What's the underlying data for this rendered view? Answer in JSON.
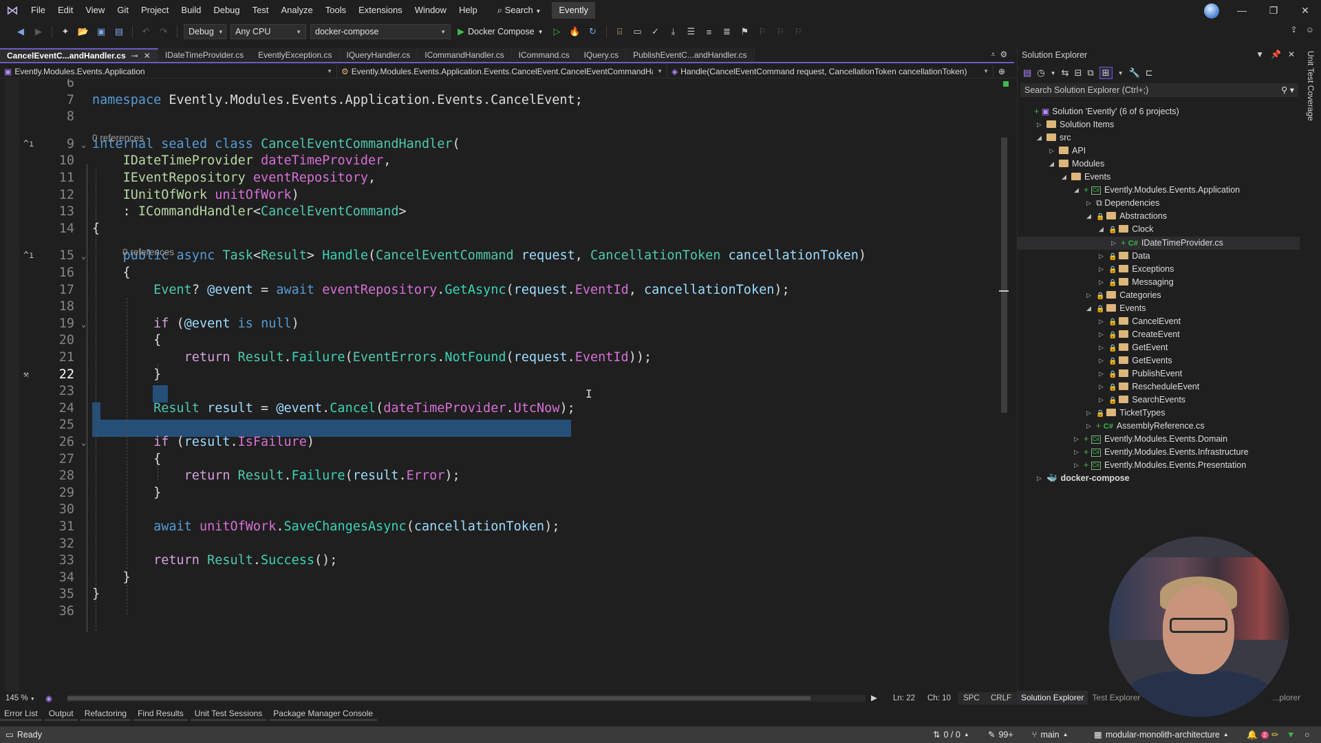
{
  "titlebar": {
    "menu": [
      "File",
      "Edit",
      "View",
      "Git",
      "Project",
      "Build",
      "Debug",
      "Test",
      "Analyze",
      "Tools",
      "Extensions",
      "Window",
      "Help"
    ],
    "search_label": "Search",
    "solution_name": "Evently"
  },
  "toolbar": {
    "configuration": "Debug",
    "platform": "Any CPU",
    "startup_project": "docker-compose",
    "run_label": "Docker Compose"
  },
  "doc_tabs": [
    {
      "label": "CancelEventC...andHandler.cs",
      "active": true
    },
    {
      "label": "IDateTimeProvider.cs"
    },
    {
      "label": "EventlyException.cs"
    },
    {
      "label": "IQueryHandler.cs"
    },
    {
      "label": "ICommandHandler.cs"
    },
    {
      "label": "ICommand.cs"
    },
    {
      "label": "IQuery.cs"
    },
    {
      "label": "PublishEventC...andHandler.cs"
    }
  ],
  "navbar": {
    "project": "Evently.Modules.Events.Application",
    "type": "Evently.Modules.Events.Application.Events.CancelEvent.CancelEventCommandHandler",
    "member": "Handle(CancelEventCommand request, CancellationToken cancellationToken)"
  },
  "editor": {
    "codelens": [
      "0 references",
      "0 references"
    ],
    "lines": [
      {
        "n": "6"
      },
      {
        "n": "7"
      },
      {
        "n": "8"
      },
      {
        "n": "9"
      },
      {
        "n": "10"
      },
      {
        "n": "11"
      },
      {
        "n": "12"
      },
      {
        "n": "13"
      },
      {
        "n": "14"
      },
      {
        "n": "15"
      },
      {
        "n": "16"
      },
      {
        "n": "17"
      },
      {
        "n": "18"
      },
      {
        "n": "19"
      },
      {
        "n": "20"
      },
      {
        "n": "21"
      },
      {
        "n": "22"
      },
      {
        "n": "23"
      },
      {
        "n": "24"
      },
      {
        "n": "25"
      },
      {
        "n": "26"
      },
      {
        "n": "27"
      },
      {
        "n": "28"
      },
      {
        "n": "29"
      },
      {
        "n": "30"
      },
      {
        "n": "31"
      },
      {
        "n": "32"
      },
      {
        "n": "33"
      },
      {
        "n": "34"
      },
      {
        "n": "35"
      },
      {
        "n": "36"
      }
    ],
    "tokens": {
      "l7": [
        [
          "kw",
          "namespace"
        ],
        [
          "pl",
          " Evently.Modules.Events.Application.Events.CancelEvent;"
        ]
      ],
      "l9": [
        [
          "kw",
          "internal"
        ],
        [
          "pl",
          " "
        ],
        [
          "kw",
          "sealed"
        ],
        [
          "pl",
          " "
        ],
        [
          "kw",
          "class"
        ],
        [
          "pl",
          " "
        ],
        [
          "cl",
          "CancelEventCommandHandler"
        ],
        [
          "pl",
          "("
        ]
      ],
      "l10": [
        [
          "pl",
          "    "
        ],
        [
          "ty",
          "IDateTimeProvider"
        ],
        [
          "pl",
          " "
        ],
        [
          "pr",
          "dateTimeProvider"
        ],
        [
          "pl",
          ","
        ]
      ],
      "l11": [
        [
          "pl",
          "    "
        ],
        [
          "ty",
          "IEventRepository"
        ],
        [
          "pl",
          " "
        ],
        [
          "pr",
          "eventRepository"
        ],
        [
          "pl",
          ","
        ]
      ],
      "l12": [
        [
          "pl",
          "    "
        ],
        [
          "ty",
          "IUnitOfWork"
        ],
        [
          "pl",
          " "
        ],
        [
          "pr",
          "unitOfWork"
        ],
        [
          "pl",
          ")"
        ]
      ],
      "l13": [
        [
          "pl",
          "    : "
        ],
        [
          "ty",
          "ICommandHandler"
        ],
        [
          "pl",
          "<"
        ],
        [
          "cl",
          "CancelEventCommand"
        ],
        [
          "pl",
          ">"
        ]
      ],
      "l14": [
        [
          "pl",
          "{"
        ]
      ],
      "l15": [
        [
          "pl",
          "    "
        ],
        [
          "kw",
          "public"
        ],
        [
          "pl",
          " "
        ],
        [
          "kw",
          "async"
        ],
        [
          "pl",
          " "
        ],
        [
          "cl",
          "Task"
        ],
        [
          "pl",
          "<"
        ],
        [
          "cl",
          "Result"
        ],
        [
          "pl",
          "> "
        ],
        [
          "me",
          "Handle"
        ],
        [
          "pl",
          "("
        ],
        [
          "cl",
          "CancelEventCommand"
        ],
        [
          "pl",
          " "
        ],
        [
          "pa",
          "request"
        ],
        [
          "pl",
          ", "
        ],
        [
          "cl",
          "CancellationToken"
        ],
        [
          "pl",
          " "
        ],
        [
          "pa",
          "cancellationToken"
        ],
        [
          "pl",
          ")"
        ]
      ],
      "l16": [
        [
          "pl",
          "    {"
        ]
      ],
      "l17": [
        [
          "pl",
          "        "
        ],
        [
          "cl",
          "Event"
        ],
        [
          "pl",
          "? "
        ],
        [
          "pa",
          "@event"
        ],
        [
          "pl",
          " = "
        ],
        [
          "kw",
          "await"
        ],
        [
          "pl",
          " "
        ],
        [
          "pr",
          "eventRepository"
        ],
        [
          "pl",
          "."
        ],
        [
          "me",
          "GetAsync"
        ],
        [
          "pl",
          "("
        ],
        [
          "pa",
          "request"
        ],
        [
          "pl",
          "."
        ],
        [
          "pr",
          "EventId"
        ],
        [
          "pl",
          ", "
        ],
        [
          "pa",
          "cancellationToken"
        ],
        [
          "pl",
          ");"
        ]
      ],
      "l19": [
        [
          "pl",
          "        "
        ],
        [
          "kw2",
          "if"
        ],
        [
          "pl",
          " ("
        ],
        [
          "pa",
          "@event"
        ],
        [
          "pl",
          " "
        ],
        [
          "kw",
          "is"
        ],
        [
          "pl",
          " "
        ],
        [
          "kw",
          "null"
        ],
        [
          "pl",
          ")"
        ]
      ],
      "l20": [
        [
          "pl",
          "        {"
        ]
      ],
      "l21": [
        [
          "pl",
          "            "
        ],
        [
          "kw2",
          "return"
        ],
        [
          "pl",
          " "
        ],
        [
          "cl",
          "Result"
        ],
        [
          "pl",
          "."
        ],
        [
          "me",
          "Failure"
        ],
        [
          "pl",
          "("
        ],
        [
          "cl",
          "EventErrors"
        ],
        [
          "pl",
          "."
        ],
        [
          "me",
          "NotFound"
        ],
        [
          "pl",
          "("
        ],
        [
          "pa",
          "request"
        ],
        [
          "pl",
          "."
        ],
        [
          "pr",
          "EventId"
        ],
        [
          "pl",
          "));"
        ]
      ],
      "l22": [
        [
          "pl",
          "        }"
        ]
      ],
      "l24": [
        [
          "pl",
          "        "
        ],
        [
          "cl",
          "Result"
        ],
        [
          "pl",
          " "
        ],
        [
          "pa",
          "result"
        ],
        [
          "pl",
          " = "
        ],
        [
          "pa",
          "@event"
        ],
        [
          "pl",
          "."
        ],
        [
          "me",
          "Cancel"
        ],
        [
          "pl",
          "("
        ],
        [
          "pr",
          "dateTimeProvider"
        ],
        [
          "pl",
          "."
        ],
        [
          "pr",
          "UtcNow"
        ],
        [
          "pl",
          ");"
        ]
      ],
      "l26": [
        [
          "pl",
          "        "
        ],
        [
          "kw2",
          "if"
        ],
        [
          "pl",
          " ("
        ],
        [
          "pa",
          "result"
        ],
        [
          "pl",
          "."
        ],
        [
          "pr",
          "IsFailure"
        ],
        [
          "pl",
          ")"
        ]
      ],
      "l27": [
        [
          "pl",
          "        {"
        ]
      ],
      "l28": [
        [
          "pl",
          "            "
        ],
        [
          "kw2",
          "return"
        ],
        [
          "pl",
          " "
        ],
        [
          "cl",
          "Result"
        ],
        [
          "pl",
          "."
        ],
        [
          "me",
          "Failure"
        ],
        [
          "pl",
          "("
        ],
        [
          "pa",
          "result"
        ],
        [
          "pl",
          "."
        ],
        [
          "pr",
          "Error"
        ],
        [
          "pl",
          ");"
        ]
      ],
      "l29": [
        [
          "pl",
          "        }"
        ]
      ],
      "l31": [
        [
          "pl",
          "        "
        ],
        [
          "kw",
          "await"
        ],
        [
          "pl",
          " "
        ],
        [
          "pr",
          "unitOfWork"
        ],
        [
          "pl",
          "."
        ],
        [
          "me",
          "SaveChangesAsync"
        ],
        [
          "pl",
          "("
        ],
        [
          "pa",
          "cancellationToken"
        ],
        [
          "pl",
          ");"
        ]
      ],
      "l33": [
        [
          "pl",
          "        "
        ],
        [
          "kw2",
          "return"
        ],
        [
          "pl",
          " "
        ],
        [
          "cl",
          "Result"
        ],
        [
          "pl",
          "."
        ],
        [
          "me",
          "Success"
        ],
        [
          "pl",
          "();"
        ]
      ],
      "l34": [
        [
          "pl",
          "    }"
        ]
      ],
      "l35": [
        [
          "pl",
          "}"
        ]
      ]
    },
    "current_line": "22",
    "zoom": "145 %",
    "line_col": {
      "ln": "Ln: 22",
      "ch": "Ch: 10"
    },
    "indent": "SPC",
    "eol": "CRLF"
  },
  "solution_explorer": {
    "title": "Solution Explorer",
    "search_placeholder": "Search Solution Explorer (Ctrl+;)",
    "tree": [
      {
        "label": "Solution 'Evently' (6 of 6 projects)",
        "depth": 0,
        "icon": "solution",
        "expand": "",
        "plus": true
      },
      {
        "label": "Solution Items",
        "depth": 1,
        "icon": "folder",
        "expand": "collapsed"
      },
      {
        "label": "src",
        "depth": 1,
        "icon": "folder",
        "expand": "expanded"
      },
      {
        "label": "API",
        "depth": 2,
        "icon": "folder",
        "expand": "collapsed"
      },
      {
        "label": "Modules",
        "depth": 2,
        "icon": "folder",
        "expand": "expanded"
      },
      {
        "label": "Events",
        "depth": 3,
        "icon": "folder",
        "expand": "expanded"
      },
      {
        "label": "Evently.Modules.Events.Application",
        "depth": 4,
        "icon": "csproj",
        "expand": "expanded",
        "plus": true
      },
      {
        "label": "Dependencies",
        "depth": 5,
        "icon": "deps",
        "expand": "collapsed"
      },
      {
        "label": "Abstractions",
        "depth": 5,
        "icon": "folder",
        "expand": "expanded",
        "lock": true
      },
      {
        "label": "Clock",
        "depth": 6,
        "icon": "folder",
        "expand": "expanded",
        "lock": true
      },
      {
        "label": "IDateTimeProvider.cs",
        "depth": 7,
        "icon": "csfile",
        "expand": "collapsed",
        "plus": true,
        "selected": true
      },
      {
        "label": "Data",
        "depth": 6,
        "icon": "folder",
        "expand": "collapsed",
        "lock": true
      },
      {
        "label": "Exceptions",
        "depth": 6,
        "icon": "folder",
        "expand": "collapsed",
        "lock": true
      },
      {
        "label": "Messaging",
        "depth": 6,
        "icon": "folder",
        "expand": "collapsed",
        "lock": true
      },
      {
        "label": "Categories",
        "depth": 5,
        "icon": "folder",
        "expand": "collapsed",
        "lock": true
      },
      {
        "label": "Events",
        "depth": 5,
        "icon": "folder",
        "expand": "expanded",
        "lock": true
      },
      {
        "label": "CancelEvent",
        "depth": 6,
        "icon": "folder",
        "expand": "collapsed",
        "lock": true
      },
      {
        "label": "CreateEvent",
        "depth": 6,
        "icon": "folder",
        "expand": "collapsed",
        "lock": true
      },
      {
        "label": "GetEvent",
        "depth": 6,
        "icon": "folder",
        "expand": "collapsed",
        "lock": true
      },
      {
        "label": "GetEvents",
        "depth": 6,
        "icon": "folder",
        "expand": "collapsed",
        "lock": true
      },
      {
        "label": "PublishEvent",
        "depth": 6,
        "icon": "folder",
        "expand": "collapsed",
        "lock": true
      },
      {
        "label": "RescheduleEvent",
        "depth": 6,
        "icon": "folder",
        "expand": "collapsed",
        "lock": true
      },
      {
        "label": "SearchEvents",
        "depth": 6,
        "icon": "folder",
        "expand": "collapsed",
        "lock": true
      },
      {
        "label": "TicketTypes",
        "depth": 5,
        "icon": "folder",
        "expand": "collapsed",
        "lock": true
      },
      {
        "label": "AssemblyReference.cs",
        "depth": 5,
        "icon": "csfile",
        "expand": "collapsed",
        "plus": true
      },
      {
        "label": "Evently.Modules.Events.Domain",
        "depth": 4,
        "icon": "csproj",
        "expand": "collapsed",
        "plus": true
      },
      {
        "label": "Evently.Modules.Events.Infrastructure",
        "depth": 4,
        "icon": "csproj",
        "expand": "collapsed",
        "plus": true
      },
      {
        "label": "Evently.Modules.Events.Presentation",
        "depth": 4,
        "icon": "csproj",
        "expand": "collapsed",
        "plus": true
      },
      {
        "label": "docker-compose",
        "depth": 1,
        "icon": "docker",
        "expand": "collapsed",
        "bold": true
      }
    ],
    "bottom_tabs": [
      "Solution Explorer",
      "Test Explorer",
      "...plorer"
    ],
    "side_rail": "Unit Test Coverage"
  },
  "tool_windows": [
    "Error List",
    "Output",
    "Refactoring",
    "Find Results",
    "Unit Test Sessions",
    "Package Manager Console"
  ],
  "statusbar": {
    "ready": "Ready",
    "sync": "0 / 0",
    "changes": "99+",
    "branch": "main",
    "repo": "modular-monolith-architecture",
    "notifications": "2"
  }
}
